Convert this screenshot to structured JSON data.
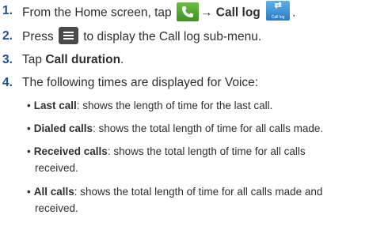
{
  "steps": [
    {
      "number": "1.",
      "pre": "From the Home screen, tap",
      "arrow": "→",
      "bold": "Call log",
      "icon_phone": "phone-icon",
      "icon_calllog": "call-log-icon",
      "calllog_icon_caption": "Call log",
      "end": "."
    },
    {
      "number": "2.",
      "pre": "Press",
      "icon": "menu-icon",
      "post": "to display the Call log sub-menu."
    },
    {
      "number": "3.",
      "pre": "Tap",
      "bold": "Call duration",
      "post": "."
    },
    {
      "number": "4.",
      "text": "The following times are displayed for Voice:"
    }
  ],
  "bullets": [
    {
      "term": "Last call",
      "desc": ": shows the length of time for the last call."
    },
    {
      "term": "Dialed calls",
      "desc": ": shows the total length of time for all calls made."
    },
    {
      "term": "Received calls",
      "desc": ": shows the total length of time for all calls",
      "cont": "received."
    },
    {
      "term": "All calls",
      "desc": ": shows the total length of time for all calls made and",
      "cont": "received."
    }
  ],
  "colors": {
    "number": "#1f4d8f",
    "text": "#2f2f2f",
    "phone_icon": "#4caf2f",
    "calllog_icon": "#3b8fd6",
    "menu_icon": "#4a4a4a"
  }
}
